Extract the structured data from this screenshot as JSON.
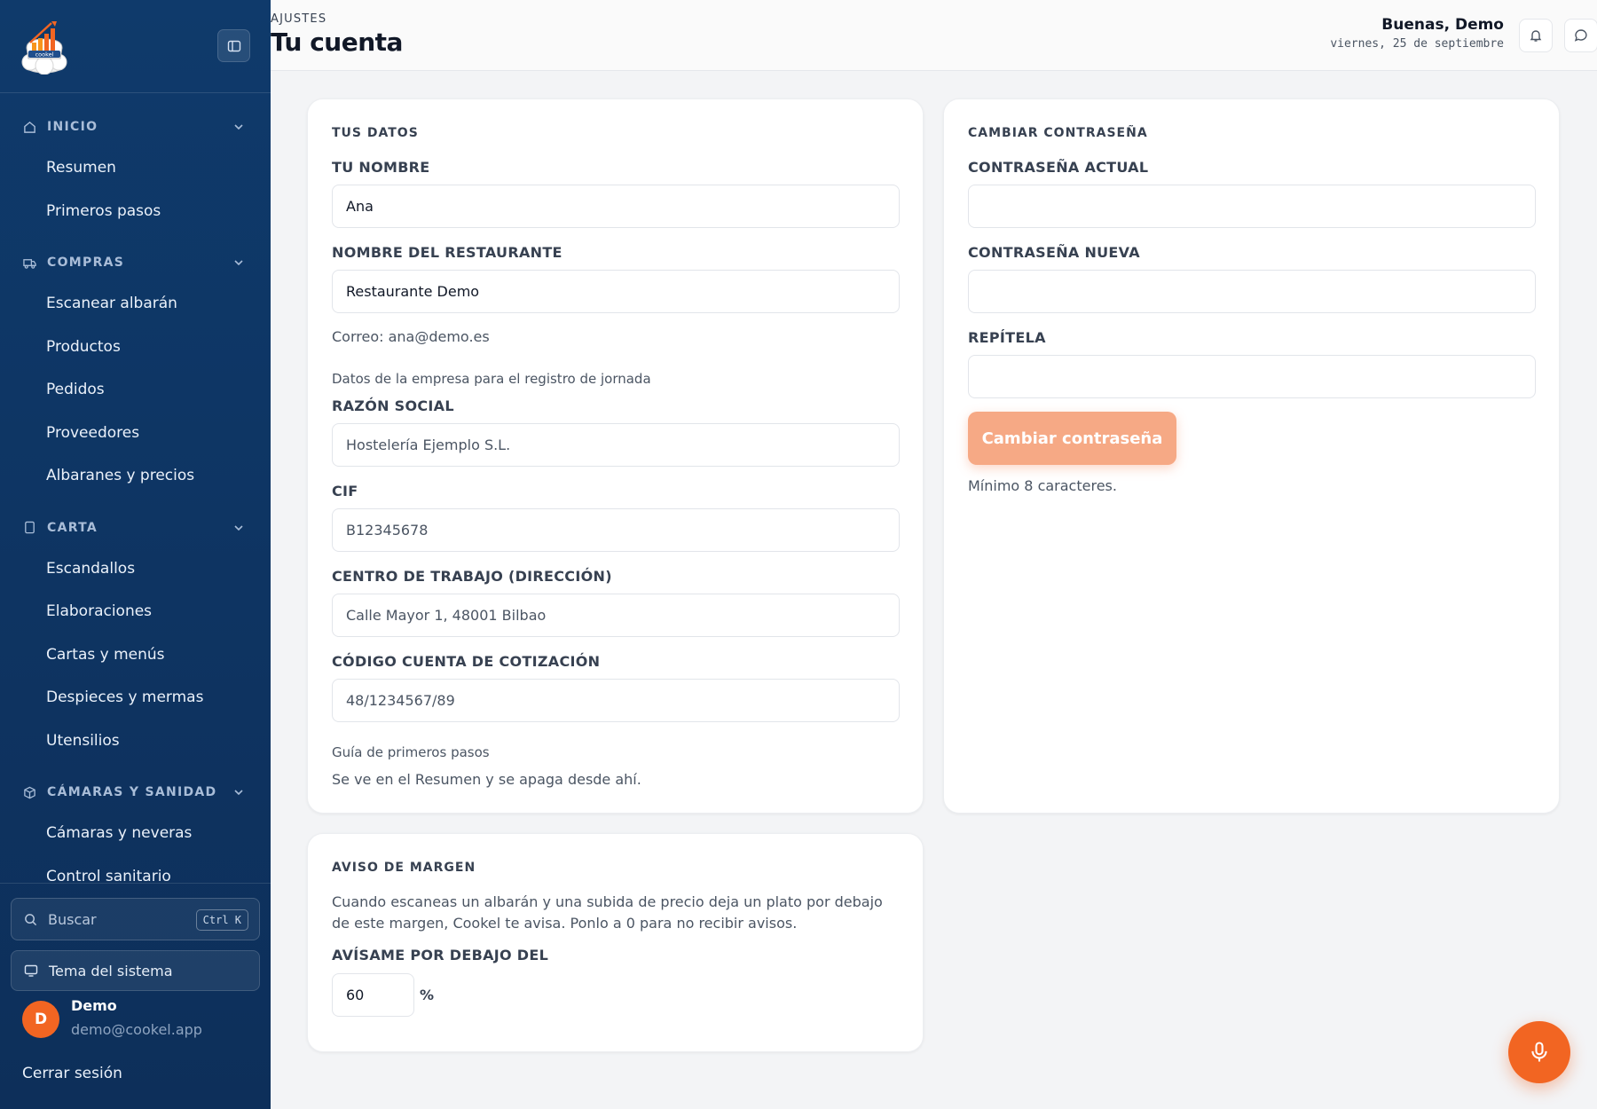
{
  "sidebar": {
    "sections": [
      {
        "label": "INICIO",
        "icon": "home-icon",
        "items": [
          "Resumen",
          "Primeros pasos"
        ]
      },
      {
        "label": "COMPRAS",
        "icon": "truck-icon",
        "items": [
          "Escanear albarán",
          "Productos",
          "Pedidos",
          "Proveedores",
          "Albaranes y precios"
        ]
      },
      {
        "label": "CARTA",
        "icon": "book-icon",
        "items": [
          "Escandallos",
          "Elaboraciones",
          "Cartas y menús",
          "Despieces y mermas",
          "Utensilios"
        ]
      },
      {
        "label": "CÁMARAS Y SANIDAD",
        "icon": "box-icon",
        "items": [
          "Cámaras y neveras",
          "Control sanitario"
        ]
      }
    ],
    "search_placeholder": "Buscar",
    "search_shortcut": "Ctrl K",
    "theme_label": "Tema del sistema",
    "user": {
      "initial": "D",
      "name": "Demo",
      "email": "demo@cookel.app"
    },
    "logout_label": "Cerrar sesión",
    "logo_text": "cookel"
  },
  "header": {
    "eyebrow": "AJUSTES",
    "title": "Tu cuenta",
    "greeting": "Buenas, Demo",
    "date": "viernes, 25 de septiembre"
  },
  "datos": {
    "title": "TUS DATOS",
    "name_label": "TU NOMBRE",
    "name_value": "Ana",
    "restaurant_label": "NOMBRE DEL RESTAURANTE",
    "restaurant_value": "Restaurante Demo",
    "email_note": "Correo: ana@demo.es",
    "company_note": "Datos de la empresa para el registro de jornada",
    "razon_label": "RAZÓN SOCIAL",
    "razon_value": "Hostelería Ejemplo S.L.",
    "cif_label": "CIF",
    "cif_value": "B12345678",
    "centro_label": "CENTRO DE TRABAJO (DIRECCIÓN)",
    "centro_value": "Calle Mayor 1, 48001 Bilbao",
    "ccc_label": "CÓDIGO CUENTA DE COTIZACIÓN",
    "ccc_value": "48/1234567/89",
    "guide_note": "Guía de primeros pasos",
    "guide_sub": "Se ve en el Resumen y se apaga desde ahí."
  },
  "password": {
    "title": "CAMBIAR CONTRASEÑA",
    "current_label": "CONTRASEÑA ACTUAL",
    "new_label": "CONTRASEÑA NUEVA",
    "repeat_label": "REPÍTELA",
    "button_label": "Cambiar contraseña",
    "hint": "Mínimo 8 caracteres."
  },
  "margin": {
    "title": "AVISO DE MARGEN",
    "description": "Cuando escaneas un albarán y una subida de precio deja un plato por debajo de este margen, Cookel te avisa. Ponlo a 0 para no recibir avisos.",
    "threshold_label": "AVÍSAME POR DEBAJO DEL",
    "threshold_value": "60",
    "unit": "%"
  },
  "colors": {
    "sidebar": "#0f3a6b",
    "accent": "#f26522",
    "button_disabled": "#f6a985"
  }
}
